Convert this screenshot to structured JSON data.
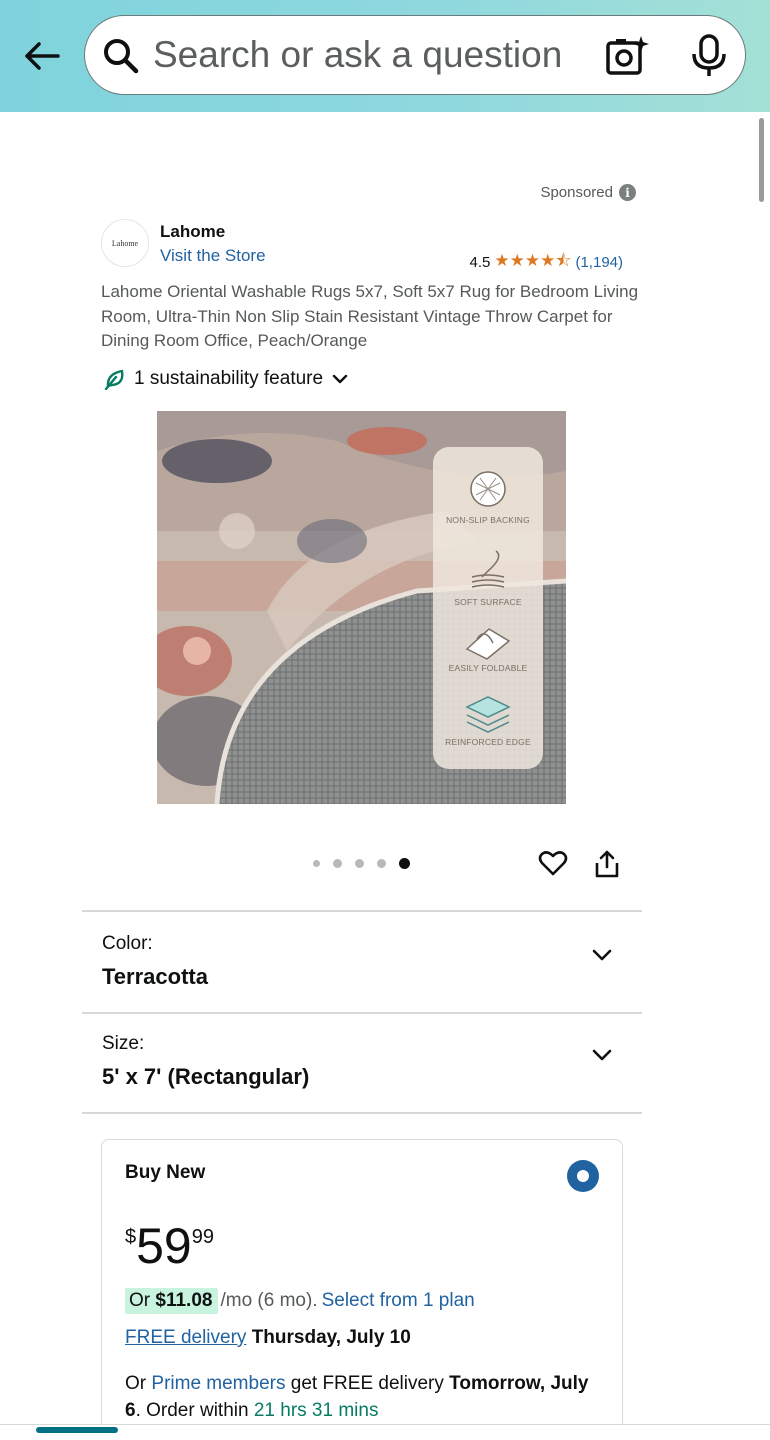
{
  "header": {
    "back_icon": "arrow-left-icon",
    "search_placeholder": "Search or ask a question",
    "camera_icon": "camera-sparkle-icon",
    "mic_icon": "microphone-icon"
  },
  "listing": {
    "sponsored_label": "Sponsored",
    "brand": {
      "logo_text": "Lahome",
      "name": "Lahome",
      "store_link": "Visit the Store"
    },
    "rating": {
      "value": "4.5",
      "stars": "★★★★⯪",
      "count": "(1,194)"
    },
    "title": "Lahome Oriental Washable Rugs 5x7, Soft 5x7 Rug for Bedroom Living Room, Ultra-Thin Non Slip Stain Resistant Vintage Throw Carpet for Dining Room Office, Peach/Orange",
    "sustainability": "1 sustainability feature",
    "image_features": [
      "NON-SLIP BACKING",
      "SOFT SURFACE",
      "EASILY FOLDABLE",
      "REINFORCED EDGE"
    ],
    "carousel": {
      "total": 5,
      "active": 5
    }
  },
  "variations": {
    "color_label": "Color:",
    "color_value": "Terracotta",
    "size_label": "Size:",
    "size_value": "5' x 7' (Rectangular)"
  },
  "buybox": {
    "heading": "Buy New",
    "price_currency": "$",
    "price_whole": "59",
    "price_fraction": "99",
    "monthly_or": "Or",
    "monthly_amount": "$11.08",
    "monthly_term": "/mo (6 mo).",
    "monthly_link": "Select from 1 plan",
    "delivery_link": "FREE delivery",
    "delivery_date": "Thursday, July 10",
    "prime_or": "Or",
    "prime_link": "Prime members",
    "prime_text": "get FREE delivery",
    "prime_date": "Tomorrow, July 6",
    "prime_order": ". Order within",
    "prime_countdown": "21 hrs 31 mins"
  },
  "colors": {
    "link": "#2162a1",
    "star": "#de7921",
    "green": "#067d62",
    "radio": "#2162a1"
  }
}
